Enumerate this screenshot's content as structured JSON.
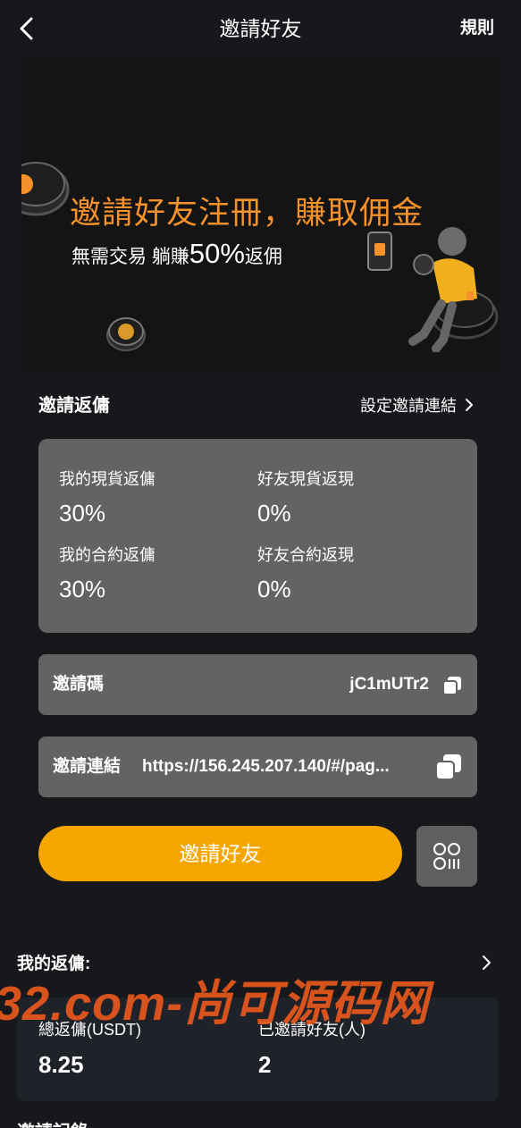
{
  "header": {
    "title": "邀請好友",
    "rules_label": "規則"
  },
  "banner": {
    "headline": "邀請好友注冊，賺取佣金",
    "sub_prefix": "無需交易 躺賺",
    "sub_highlight": "50%",
    "sub_suffix": "返佣"
  },
  "invite_rebate": {
    "title": "邀請返傭",
    "set_link_label": "設定邀請連結",
    "items": [
      {
        "label": "我的現貨返傭",
        "value": "30%"
      },
      {
        "label": "好友現貨返現",
        "value": "0%"
      },
      {
        "label": "我的合約返傭",
        "value": "30%"
      },
      {
        "label": "好友合約返現",
        "value": "0%"
      }
    ]
  },
  "invite_code": {
    "label": "邀請碼",
    "value": "jC1mUTr2"
  },
  "invite_link": {
    "label": "邀請連結",
    "value": "https://156.245.207.140/#/pag..."
  },
  "invite_button_label": "邀請好友",
  "my_rebate": {
    "title": "我的返傭:",
    "total_label": "總返傭(USDT)",
    "total_value": "8.25",
    "invited_label": "已邀請好友(人)",
    "invited_value": "2"
  },
  "watermark": "32.com-尚可源码网",
  "partial_bottom_text": "邀請記錄",
  "colors": {
    "accent": "#f6a600",
    "headline": "#f5922b",
    "card": "#636363",
    "background": "#16181c"
  }
}
